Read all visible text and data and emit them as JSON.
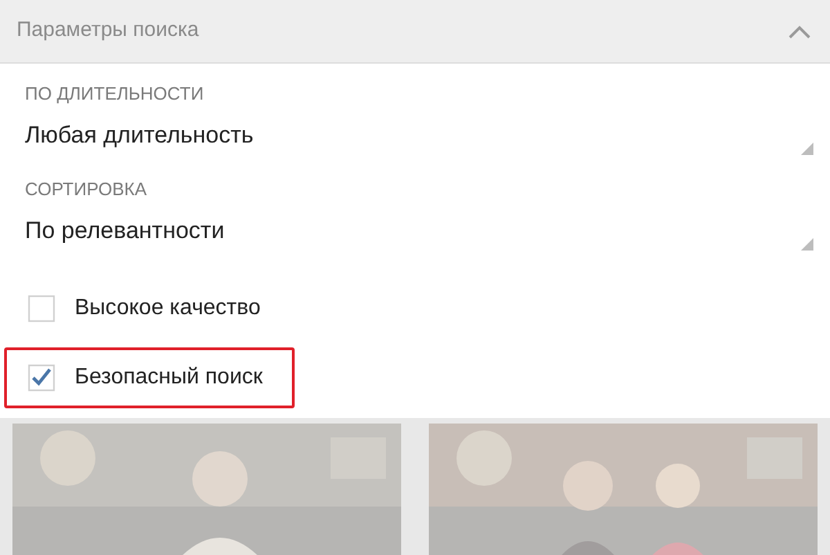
{
  "header": {
    "title": "Параметры поиска",
    "expanded": true
  },
  "selects": [
    {
      "label": "ПО ДЛИТЕЛЬНОСТИ",
      "value": "Любая длительность"
    },
    {
      "label": "СОРТИРОВКА",
      "value": "По релевантности"
    }
  ],
  "checkboxes": [
    {
      "label": "Высокое качество",
      "checked": false,
      "highlighted": false
    },
    {
      "label": "Безопасный поиск",
      "checked": true,
      "highlighted": true
    }
  ]
}
